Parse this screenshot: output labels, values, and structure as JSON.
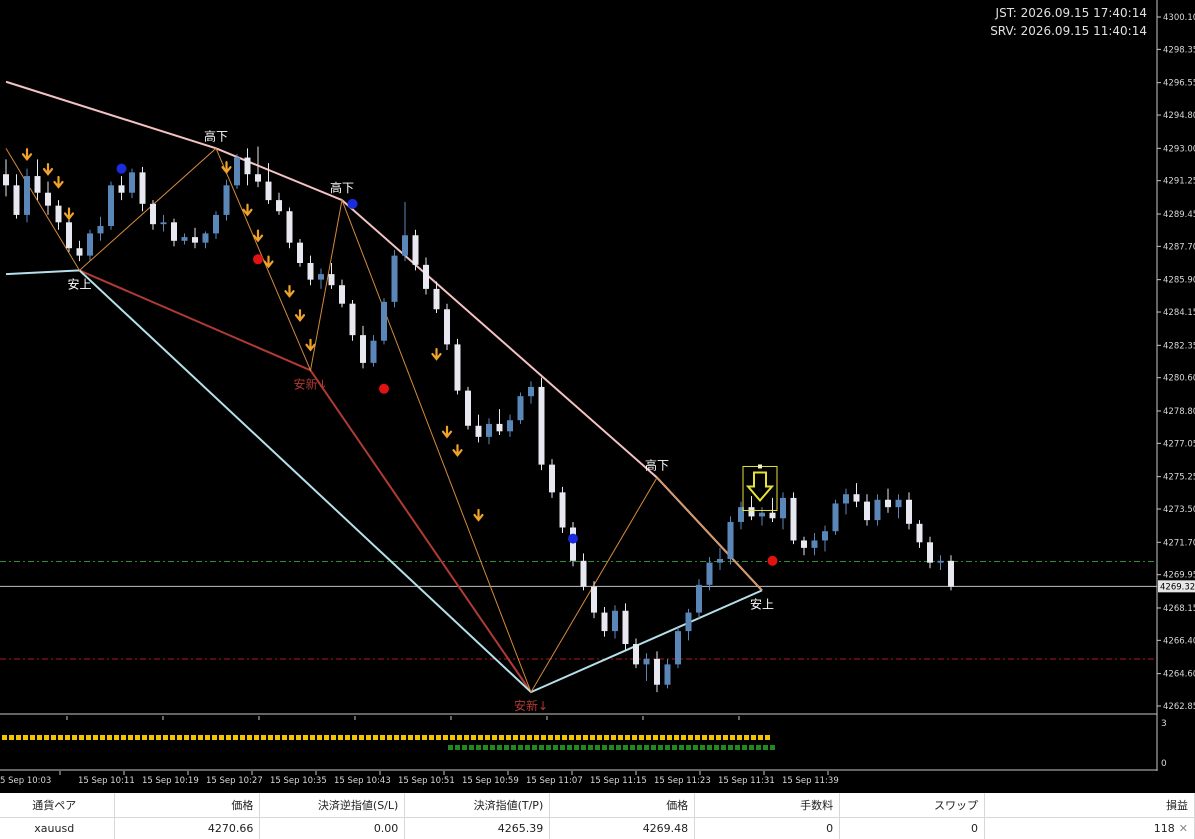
{
  "clock": {
    "jst": "JST: 2026.09.15 17:40:14",
    "srv": "SRV: 2026.09.15 11:40:14"
  },
  "colors": {
    "bull_candle": "#5b86b8",
    "bear_candle": "#e8e8f0",
    "downtrend_line": "#f4c2c2",
    "uptrend_line": "#b5e0ea",
    "lower_line": "#b03a34",
    "zigzag": "#d58a3b",
    "signal_arrow": "#f0a32a",
    "sell_dot": "#e01212",
    "buy_dot": "#1a2cdc",
    "green_bar": "#1f8a1f",
    "yellow_bar": "#f5c400"
  },
  "price_axis": {
    "min": 4262.85,
    "max": 4300.1,
    "ticks": [
      "4300.10",
      "4298.35",
      "4296.55",
      "4294.80",
      "4293.00",
      "4291.25",
      "4289.45",
      "4287.70",
      "4285.90",
      "4284.15",
      "4282.35",
      "4280.60",
      "4278.80",
      "4277.05",
      "4275.25",
      "4273.50",
      "4271.70",
      "4269.95",
      "4268.15",
      "4266.40",
      "4264.60",
      "4262.85"
    ],
    "current_price": "4269.32",
    "current_price_value": 4269.32
  },
  "levels": {
    "tp_dash_green": 4270.66,
    "sl_dash_red": 4265.39
  },
  "labels": {
    "high_down": "高下",
    "low_up": "安上",
    "low_new": "安新↓"
  },
  "day_markers": [
    "15_16",
    "15_16",
    "15_16",
    "15_16",
    "15_17",
    "15_17",
    "15_17",
    "15_17"
  ],
  "indicator_scale": [
    "3",
    "0"
  ],
  "time_axis": [
    "5 Sep 10:03",
    "15 Sep 10:11",
    "15 Sep 10:19",
    "15 Sep 10:27",
    "15 Sep 10:35",
    "15 Sep 10:43",
    "15 Sep 10:51",
    "15 Sep 10:59",
    "15 Sep 11:07",
    "15 Sep 11:15",
    "15 Sep 11:23",
    "15 Sep 11:31",
    "15 Sep 11:39"
  ],
  "chart_data": {
    "type": "candlestick",
    "symbol": "xauusd",
    "ylim": [
      4262.85,
      4300.1
    ],
    "candles": [
      [
        4291.6,
        4292.4,
        4290.4,
        4291.0
      ],
      [
        4291.0,
        4291.6,
        4289.2,
        4289.4
      ],
      [
        4289.4,
        4291.9,
        4289.0,
        4291.5
      ],
      [
        4291.5,
        4292.4,
        4290.2,
        4290.6
      ],
      [
        4290.6,
        4291.2,
        4289.4,
        4289.9
      ],
      [
        4289.9,
        4290.2,
        4288.6,
        4289.0
      ],
      [
        4289.0,
        4289.4,
        4287.4,
        4287.6
      ],
      [
        4287.6,
        4288.0,
        4286.9,
        4287.2
      ],
      [
        4287.2,
        4288.6,
        4286.9,
        4288.4
      ],
      [
        4288.4,
        4289.3,
        4288.0,
        4288.8
      ],
      [
        4288.8,
        4291.2,
        4288.6,
        4291.0
      ],
      [
        4291.0,
        4291.5,
        4290.2,
        4290.6
      ],
      [
        4290.6,
        4291.9,
        4290.3,
        4291.7
      ],
      [
        4291.7,
        4292.0,
        4289.6,
        4290.0
      ],
      [
        4290.0,
        4290.2,
        4288.6,
        4288.9
      ],
      [
        4288.9,
        4289.4,
        4288.5,
        4289.0
      ],
      [
        4289.0,
        4289.2,
        4287.7,
        4288.0
      ],
      [
        4288.0,
        4288.4,
        4287.8,
        4288.2
      ],
      [
        4288.2,
        4288.7,
        4287.6,
        4287.9
      ],
      [
        4287.9,
        4288.5,
        4287.6,
        4288.4
      ],
      [
        4288.4,
        4289.6,
        4288.1,
        4289.4
      ],
      [
        4289.4,
        4291.3,
        4289.1,
        4291.0
      ],
      [
        4291.0,
        4292.7,
        4290.8,
        4292.5
      ],
      [
        4292.5,
        4293.0,
        4291.0,
        4291.6
      ],
      [
        4291.6,
        4293.1,
        4290.9,
        4291.2
      ],
      [
        4291.2,
        4292.2,
        4290.0,
        4290.2
      ],
      [
        4290.2,
        4290.6,
        4289.4,
        4289.6
      ],
      [
        4289.6,
        4289.8,
        4287.6,
        4287.9
      ],
      [
        4287.9,
        4288.1,
        4286.6,
        4286.8
      ],
      [
        4286.8,
        4287.2,
        4285.6,
        4285.9
      ],
      [
        4285.9,
        4286.5,
        4285.4,
        4286.2
      ],
      [
        4286.2,
        4286.8,
        4285.4,
        4285.6
      ],
      [
        4285.6,
        4285.9,
        4284.4,
        4284.6
      ],
      [
        4284.6,
        4284.8,
        4282.6,
        4282.9
      ],
      [
        4282.9,
        4283.4,
        4281.1,
        4281.4
      ],
      [
        4281.4,
        4282.9,
        4281.2,
        4282.6
      ],
      [
        4282.6,
        4284.9,
        4282.4,
        4284.7
      ],
      [
        4284.7,
        4287.5,
        4284.4,
        4287.2
      ],
      [
        4287.2,
        4290.1,
        4286.9,
        4288.3
      ],
      [
        4288.3,
        4288.6,
        4286.4,
        4286.7
      ],
      [
        4286.7,
        4287.1,
        4285.1,
        4285.4
      ],
      [
        4285.4,
        4285.8,
        4284.1,
        4284.3
      ],
      [
        4284.3,
        4284.6,
        4282.1,
        4282.4
      ],
      [
        4282.4,
        4282.7,
        4279.7,
        4279.9
      ],
      [
        4279.9,
        4280.1,
        4277.8,
        4278.0
      ],
      [
        4278.0,
        4278.6,
        4277.1,
        4277.4
      ],
      [
        4277.4,
        4278.4,
        4277.0,
        4278.1
      ],
      [
        4278.1,
        4278.9,
        4277.5,
        4277.7
      ],
      [
        4277.7,
        4278.6,
        4277.4,
        4278.3
      ],
      [
        4278.3,
        4279.8,
        4278.1,
        4279.6
      ],
      [
        4279.6,
        4280.4,
        4279.2,
        4280.1
      ],
      [
        4280.1,
        4280.6,
        4275.6,
        4275.9
      ],
      [
        4275.9,
        4276.2,
        4274.1,
        4274.4
      ],
      [
        4274.4,
        4274.7,
        4272.2,
        4272.5
      ],
      [
        4272.5,
        4272.8,
        4270.4,
        4270.7
      ],
      [
        4270.7,
        4271.1,
        4269.1,
        4269.3
      ],
      [
        4269.3,
        4269.6,
        4267.6,
        4267.9
      ],
      [
        4267.9,
        4268.2,
        4266.6,
        4266.9
      ],
      [
        4266.9,
        4268.3,
        4266.5,
        4268.0
      ],
      [
        4268.0,
        4268.4,
        4265.9,
        4266.2
      ],
      [
        4266.2,
        4266.5,
        4264.9,
        4265.1
      ],
      [
        4265.1,
        4265.7,
        4264.2,
        4265.4
      ],
      [
        4265.4,
        4265.8,
        4263.6,
        4264.0
      ],
      [
        4264.0,
        4265.4,
        4263.8,
        4265.1
      ],
      [
        4265.1,
        4267.1,
        4264.9,
        4266.9
      ],
      [
        4266.9,
        4268.1,
        4266.4,
        4267.9
      ],
      [
        4267.9,
        4269.7,
        4267.6,
        4269.4
      ],
      [
        4269.4,
        4270.9,
        4269.1,
        4270.6
      ],
      [
        4270.6,
        4271.4,
        4270.2,
        4270.8
      ],
      [
        4270.8,
        4273.1,
        4270.5,
        4272.8
      ],
      [
        4272.8,
        4273.9,
        4272.4,
        4273.6
      ],
      [
        4273.6,
        4274.2,
        4272.9,
        4273.1
      ],
      [
        4273.1,
        4273.6,
        4272.6,
        4273.3
      ],
      [
        4273.3,
        4274.1,
        4272.8,
        4273.0
      ],
      [
        4273.0,
        4274.4,
        4272.4,
        4274.1
      ],
      [
        4274.1,
        4274.4,
        4271.6,
        4271.8
      ],
      [
        4271.8,
        4272.0,
        4271.0,
        4271.4
      ],
      [
        4271.4,
        4272.2,
        4271.0,
        4271.8
      ],
      [
        4271.8,
        4272.6,
        4271.2,
        4272.3
      ],
      [
        4272.3,
        4274.0,
        4272.1,
        4273.8
      ],
      [
        4273.8,
        4274.6,
        4273.2,
        4274.3
      ],
      [
        4274.3,
        4274.9,
        4273.6,
        4273.9
      ],
      [
        4273.9,
        4274.3,
        4272.6,
        4272.9
      ],
      [
        4272.9,
        4274.3,
        4272.6,
        4274.0
      ],
      [
        4274.0,
        4274.6,
        4273.3,
        4273.6
      ],
      [
        4273.6,
        4274.3,
        4273.0,
        4274.0
      ],
      [
        4274.0,
        4274.4,
        4272.4,
        4272.7
      ],
      [
        4272.7,
        4272.9,
        4271.4,
        4271.7
      ],
      [
        4271.7,
        4272.0,
        4270.3,
        4270.6
      ],
      [
        4270.6,
        4271.0,
        4270.2,
        4270.7
      ],
      [
        4270.7,
        4271.0,
        4269.1,
        4269.3
      ]
    ],
    "buy_dots": [
      [
        11,
        4291.9
      ],
      [
        54,
        4271.9
      ],
      [
        33,
        4290.0
      ]
    ],
    "sell_dots": [
      [
        24,
        4287.0
      ],
      [
        36,
        4280.0
      ],
      [
        73,
        4270.7
      ]
    ],
    "down_arrows": [
      [
        2,
        4292.3
      ],
      [
        4,
        4291.5
      ],
      [
        5,
        4290.8
      ],
      [
        6,
        4289.1
      ],
      [
        21,
        4291.6
      ],
      [
        23,
        4289.3
      ],
      [
        24,
        4287.9
      ],
      [
        25,
        4286.5
      ],
      [
        27,
        4284.9
      ],
      [
        28,
        4283.6
      ],
      [
        29,
        4282.0
      ],
      [
        41,
        4281.5
      ],
      [
        42,
        4277.3
      ],
      [
        43,
        4276.3
      ],
      [
        45,
        4272.8
      ]
    ],
    "zigzag": [
      [
        0,
        4293.0
      ],
      [
        7,
        4286.4
      ],
      [
        20,
        4293.0
      ],
      [
        29,
        4281.0
      ],
      [
        32,
        4290.2
      ],
      [
        50,
        4263.6
      ],
      [
        62,
        4275.2
      ],
      [
        72,
        4269.1
      ]
    ],
    "downtrend_line": [
      [
        0,
        4296.6
      ],
      [
        20,
        4293.0
      ],
      [
        32,
        4290.2
      ],
      [
        62,
        4275.2
      ],
      [
        72,
        4269.1
      ]
    ],
    "lower_trend_line": [
      [
        7,
        4286.4
      ],
      [
        29,
        4281.0
      ],
      [
        50,
        4263.6
      ]
    ],
    "uptrend_line": [
      [
        0,
        4286.2
      ],
      [
        7,
        4286.4
      ],
      [
        50,
        4263.6
      ],
      [
        72,
        4269.1
      ]
    ],
    "zigzag_labels": [
      [
        20,
        4293.0,
        "high_down",
        "above"
      ],
      [
        32,
        4290.2,
        "high_down",
        "above"
      ],
      [
        62,
        4275.2,
        "high_down",
        "above"
      ],
      [
        7,
        4286.4,
        "low_up",
        "below"
      ],
      [
        29,
        4281.0,
        "low_new",
        "below"
      ],
      [
        50,
        4263.6,
        "low_new",
        "below"
      ],
      [
        72,
        4269.1,
        "low_up",
        "below"
      ]
    ]
  },
  "positions": {
    "headers": [
      "通貨ペア",
      "価格",
      "決済逆指値(S/L)",
      "決済指値(T/P)",
      "価格",
      "手数料",
      "スワップ",
      "損益"
    ],
    "row": [
      "xauusd",
      "4270.66",
      "0.00",
      "4265.39",
      "4269.48",
      "0",
      "0",
      "118"
    ],
    "close_icon": "close-icon"
  }
}
